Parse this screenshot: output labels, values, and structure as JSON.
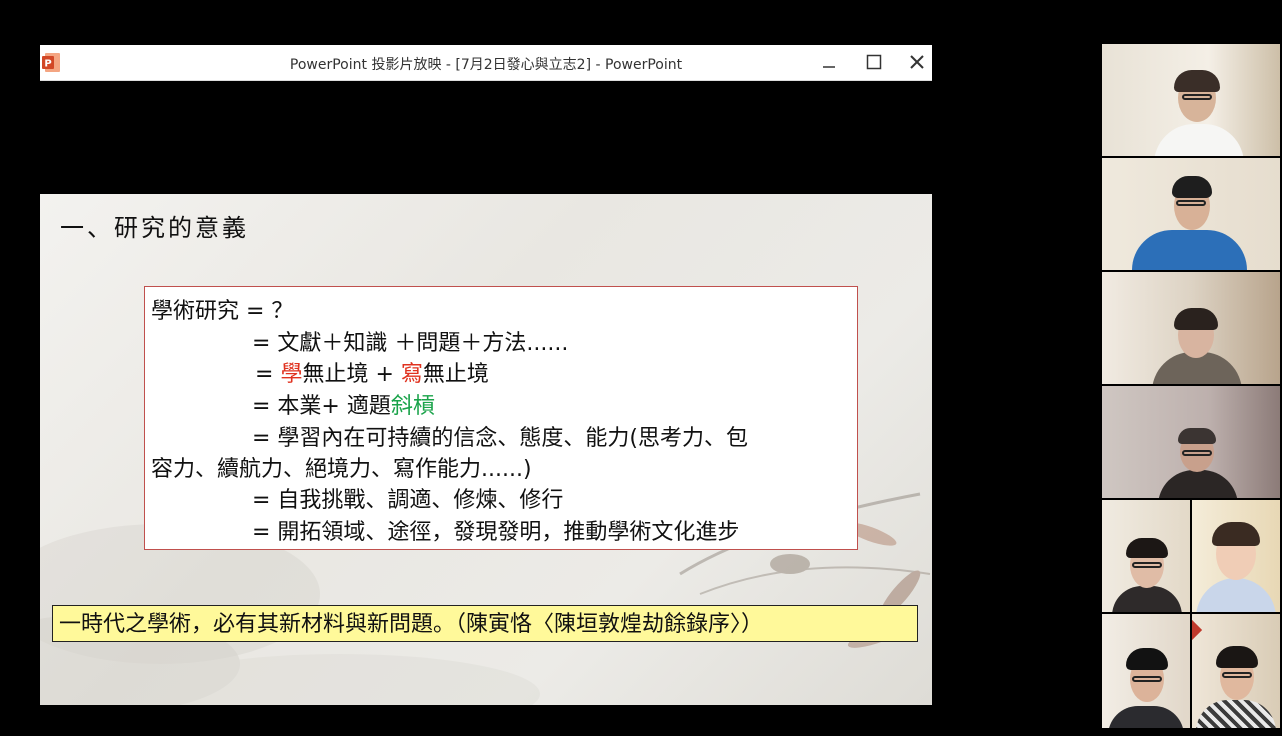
{
  "window": {
    "title": "PowerPoint 投影片放映 - [7月2日發心與立志2] - PowerPoint",
    "buttons": [
      "minimize",
      "maximize",
      "close"
    ]
  },
  "slide": {
    "title": "一、研究的意義",
    "box_lines": [
      {
        "segments": [
          {
            "text": "學術研究 = ？"
          }
        ]
      },
      {
        "segments": [
          {
            "text": "= 文獻＋知識 ＋問題＋方法......"
          }
        ]
      },
      {
        "segments": [
          {
            "text": "= "
          },
          {
            "text": "學",
            "color": "#e0321f"
          },
          {
            "text": "無止境 + "
          },
          {
            "text": "寫",
            "color": "#e0321f"
          },
          {
            "text": "無止境"
          }
        ]
      },
      {
        "segments": [
          {
            "text": "=  本業+ 適題"
          },
          {
            "text": "斜槓",
            "color": "#1aa34a"
          }
        ]
      },
      {
        "segments": [
          {
            "text": "= 學習內在可持續的信念、態度、能力(思考力、包"
          }
        ]
      },
      {
        "segments": [
          {
            "text": "容力、續航力、絕境力、寫作能力......)"
          }
        ]
      },
      {
        "segments": [
          {
            "text": "= 自我挑戰、調適、修煉、修行"
          }
        ]
      },
      {
        "segments": [
          {
            "text": "= 開拓領域、途徑，發現發明，推動學術文化進步"
          }
        ]
      }
    ],
    "quote": "一時代之學術，必有其新材料與新問題。（陳寅恪〈陳垣敦煌劫餘錄序〉）"
  },
  "gallery": {
    "participants": [
      {
        "id": "p1",
        "desc": "woman-with-glasses"
      },
      {
        "id": "p2",
        "desc": "man-blue-hoodie"
      },
      {
        "id": "p3",
        "desc": "young-woman"
      },
      {
        "id": "p4",
        "desc": "older-man-glasses"
      },
      {
        "id": "p5",
        "desc": "young-woman-glasses"
      },
      {
        "id": "p6",
        "desc": "young-woman-plaid"
      },
      {
        "id": "p7",
        "desc": "young-man-glasses"
      },
      {
        "id": "p8",
        "desc": "young-man-plaid-glasses"
      }
    ]
  },
  "colors": {
    "accent_red": "#e0321f",
    "accent_green": "#1aa34a",
    "box_border": "#c0504d",
    "quote_bg": "#fff99a"
  }
}
